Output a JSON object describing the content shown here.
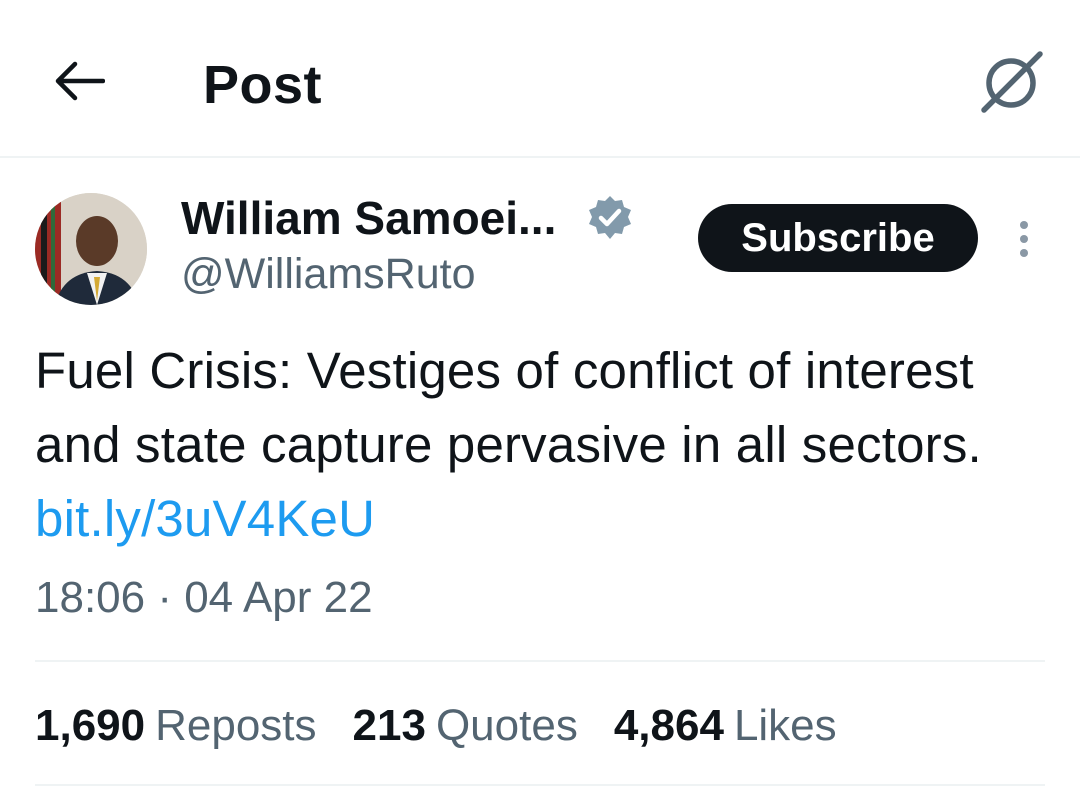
{
  "header": {
    "title": "Post",
    "back_icon": "arrow-left-icon",
    "grok_icon": "grok-icon"
  },
  "author": {
    "name": "William Samoei...",
    "handle": "@WilliamsRuto",
    "verified": true,
    "verified_color": "#829aab",
    "avatar_icon": "profile-photo"
  },
  "actions": {
    "subscribe_label": "Subscribe",
    "more_icon": "more-vertical-icon"
  },
  "post": {
    "text": "Fuel Crisis: Vestiges of conflict of interest and state capture pervasive in all sectors.",
    "link_text": "bit.ly/3uV4KeU",
    "link_color": "#1d9bf0",
    "timestamp": "18:06 · 04 Apr 22"
  },
  "stats": [
    {
      "count": "1,690",
      "label": "Reposts"
    },
    {
      "count": "213",
      "label": "Quotes"
    },
    {
      "count": "4,864",
      "label": "Likes"
    }
  ],
  "colors": {
    "primary_text": "#0f1419",
    "secondary_text": "#536471",
    "button_bg": "#0f1419",
    "divider": "#eff3f4"
  }
}
